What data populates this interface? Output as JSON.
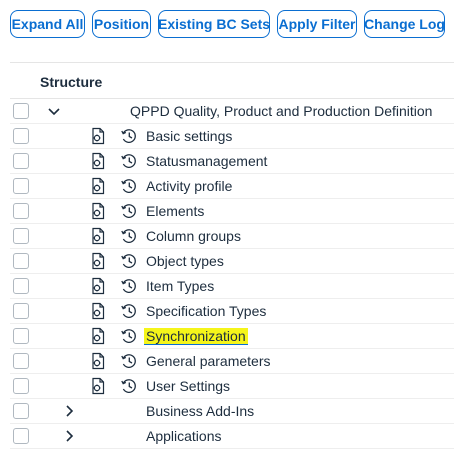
{
  "toolbar": {
    "buttons": [
      "Expand All",
      "Position",
      "Existing BC Sets",
      "Apply Filter",
      "Change Log"
    ]
  },
  "tree": {
    "header": "Structure",
    "root": {
      "label": "QPPD Quality, Product and Production Definition",
      "expanded": true
    },
    "children": [
      "Basic settings",
      "Statusmanagement",
      "Activity profile",
      "Elements",
      "Column groups",
      "Object types",
      "Item Types",
      "Specification Types",
      "Synchronization",
      "General parameters",
      "User Settings"
    ],
    "highlighted": "Synchronization",
    "collapsed_nodes": [
      "Business Add-Ins",
      "Applications"
    ]
  },
  "colors": {
    "accent": "#0a6ed1",
    "highlight": "#f5f51a",
    "text": "#1d2d3e"
  }
}
